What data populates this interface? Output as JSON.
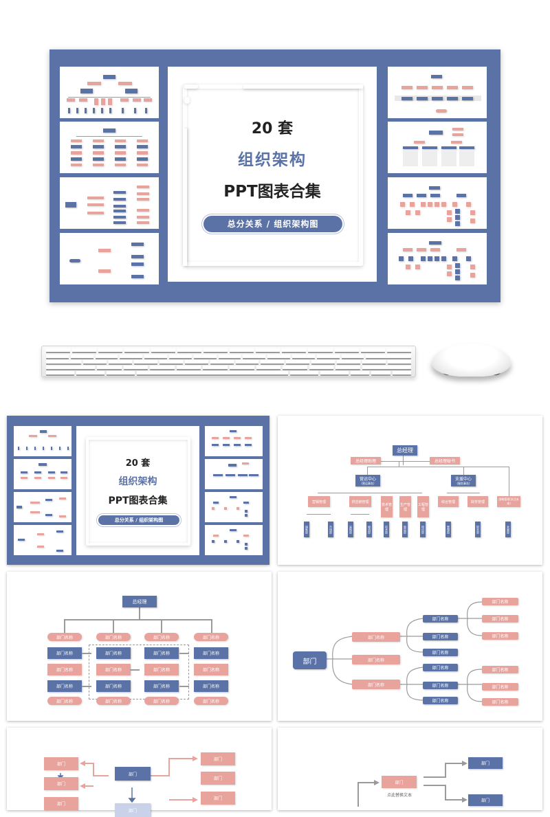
{
  "cover": {
    "count_label": "20 套",
    "title": "组织架构",
    "subtitle": "PPT图表合集",
    "tag": "总分关系 / 组织架构图"
  },
  "colors": {
    "brand_blue": "#5a72a6",
    "salmon": "#e8a39d",
    "line_gray": "#9a9a9a"
  },
  "slide2": {
    "root": "总经理",
    "assistants": [
      "总经理助理",
      "总经理秘书"
    ],
    "centers": [
      {
        "name": "营运中心",
        "note": "(营运事务)"
      },
      {
        "name": "支援中心",
        "note": "(服务事务)"
      }
    ],
    "depts": [
      "营销管理",
      "供应链管理",
      "技术管理",
      "生产管理",
      "工程管理",
      "综合管理",
      "财务管理",
      "战略管理(关注未来)"
    ],
    "units": [
      "销售部",
      "市场部",
      "采购部",
      "物流部",
      "技术部",
      "制造部",
      "项目部",
      "管理部",
      "财务部",
      "发展部"
    ]
  },
  "slide3": {
    "root": "总经理",
    "cell": "部门名称"
  },
  "slide4": {
    "root": "部门",
    "cell": "部门名称"
  },
  "slide5": {
    "cell": "部门"
  },
  "slide6": {
    "cell": "部门",
    "caption": "点此替换文本"
  }
}
